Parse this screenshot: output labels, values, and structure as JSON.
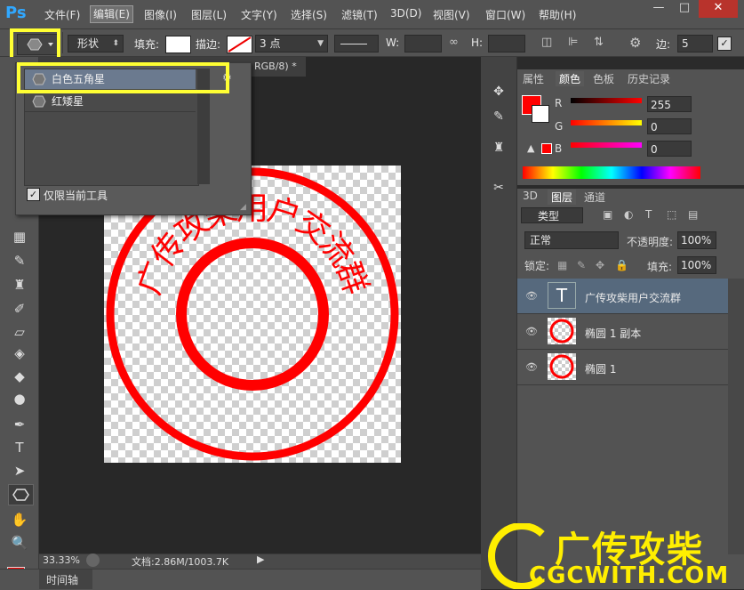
{
  "app": {
    "logo": "Ps"
  },
  "menu": [
    "文件(F)",
    "编辑(E)",
    "图像(I)",
    "图层(L)",
    "文字(Y)",
    "选择(S)",
    "滤镜(T)",
    "3D(D)",
    "视图(V)",
    "窗口(W)",
    "帮助(H)"
  ],
  "window_buttons": [
    "—",
    "□",
    "✕"
  ],
  "options": {
    "mode": "形状",
    "fill_label": "填充:",
    "stroke_label": "描边:",
    "stroke_width": "3 点",
    "w_label": "W:",
    "h_label": "H:",
    "sides_label": "边:",
    "sides_value": "5"
  },
  "document": {
    "tab_text": "RGB/8) *",
    "zoom": "33.33%",
    "doc_info": "文档:2.86M/1003.7K"
  },
  "timeline_label": "时间轴",
  "preset_dropdown": {
    "items": [
      "白色五角星",
      "红矮星"
    ],
    "checkbox_label": "仅限当前工具",
    "checked": true
  },
  "seal": {
    "text_chars": [
      "广",
      "传",
      "攻",
      "柴",
      "用",
      "户",
      "交",
      "流",
      "群"
    ],
    "color": "#ff0000"
  },
  "color_panel": {
    "tabs": [
      "属性",
      "颜色",
      "色板",
      "历史记录"
    ],
    "active_tab": "颜色",
    "channels": [
      {
        "label": "R",
        "value": "255"
      },
      {
        "label": "G",
        "value": "0"
      },
      {
        "label": "B",
        "value": "0"
      }
    ],
    "foreground": "#ff0000"
  },
  "layers_panel": {
    "tabs": [
      "3D",
      "图层",
      "通道"
    ],
    "active_tab": "图层",
    "filter_label": "类型",
    "blend_mode": "正常",
    "opacity_label": "不透明度:",
    "opacity_value": "100%",
    "lock_label": "锁定:",
    "fill_label": "填充:",
    "fill_value": "100%",
    "layers": [
      {
        "name": "广传攻柴用户交流群",
        "kind": "text",
        "selected": true
      },
      {
        "name": "椭圆 1 副本",
        "kind": "shape",
        "selected": false
      },
      {
        "name": "椭圆 1",
        "kind": "shape",
        "selected": false
      }
    ]
  },
  "watermark": {
    "line1": "广传攻柴",
    "line2": "CGCWITH.COM"
  },
  "colors": {
    "accent_highlight": "#ffff33",
    "seal_red": "#ff0000",
    "selected_layer": "#56697d"
  }
}
